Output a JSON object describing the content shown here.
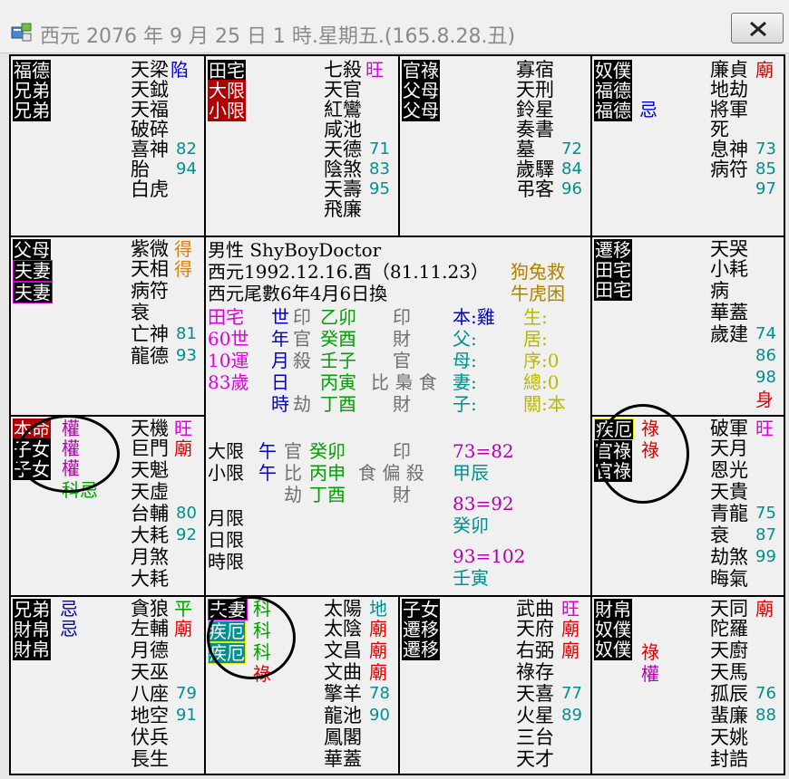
{
  "window": {
    "title": "西元 2076 年 9 月 25 日 1 時.星期五.(165.8.28.丑)",
    "close_label": "✕"
  },
  "palaces": [
    {
      "labels": [
        "福德",
        "兄弟",
        "兄弟"
      ],
      "stars": [
        [
          "天梁",
          "陷"
        ],
        [
          "天鉞",
          ""
        ],
        [
          "天福",
          ""
        ],
        [
          "破碎",
          ""
        ],
        [
          "喜神",
          "82"
        ],
        [
          "胎",
          "94"
        ],
        [
          "白虎",
          ""
        ]
      ]
    },
    {
      "labels": [
        "田宅",
        "大限",
        "小限"
      ],
      "stars": [
        [
          "七殺",
          "旺"
        ],
        [
          "天官",
          ""
        ],
        [
          "紅鸞",
          ""
        ],
        [
          "咸池",
          ""
        ],
        [
          "天德",
          "71"
        ],
        [
          "陰煞",
          "83"
        ],
        [
          "天壽",
          "95"
        ],
        [
          "飛廉",
          ""
        ]
      ]
    },
    {
      "labels": [
        "官祿",
        "父母",
        "父母"
      ],
      "stars": [
        [
          "寡宿",
          ""
        ],
        [
          "天刑",
          ""
        ],
        [
          "鈴星",
          ""
        ],
        [
          "奏書",
          ""
        ],
        [
          "墓",
          "72"
        ],
        [
          "歲驛",
          "84"
        ],
        [
          "弔客",
          "96"
        ]
      ]
    },
    {
      "labels": [
        "奴僕",
        "福德",
        "福德"
      ],
      "side": "忌",
      "stars": [
        [
          "廉貞",
          "廟"
        ],
        [
          "地劫",
          ""
        ],
        [
          "將軍",
          ""
        ],
        [
          "死",
          ""
        ],
        [
          "息神",
          "73"
        ],
        [
          "病符",
          "85"
        ],
        [
          "",
          "97"
        ]
      ]
    },
    {
      "labels": [
        "父母",
        "夫妻",
        "夫妻"
      ],
      "stars": [
        [
          "紫微",
          "得"
        ],
        [
          "天相",
          "得"
        ],
        [
          "病符",
          ""
        ],
        [
          "衰",
          ""
        ],
        [
          "亡神",
          "81"
        ],
        [
          "龍德",
          "93"
        ]
      ]
    },
    {
      "labels": [
        "遷移",
        "田宅",
        "田宅"
      ],
      "stars": [
        [
          "天哭",
          ""
        ],
        [
          "小耗",
          ""
        ],
        [
          "病",
          ""
        ],
        [
          "華蓋",
          ""
        ],
        [
          "歲建",
          "74"
        ],
        [
          "",
          "86"
        ],
        [
          "",
          "98"
        ],
        [
          "",
          "身"
        ]
      ]
    },
    {
      "labels": [
        "本命",
        "子女",
        "子女"
      ],
      "side": [
        "權",
        "權",
        "權",
        "科忌"
      ],
      "stars": [
        [
          "天機",
          "旺"
        ],
        [
          "巨門",
          "廟"
        ],
        [
          "天魁",
          ""
        ],
        [
          "天虛",
          ""
        ],
        [
          "台輔",
          "80"
        ],
        [
          "大耗",
          "92"
        ],
        [
          "月煞",
          ""
        ],
        [
          "大耗",
          ""
        ]
      ]
    },
    {
      "labels": [
        "疾厄",
        "官祿",
        "官祿"
      ],
      "side": [
        "祿",
        "祿"
      ],
      "stars": [
        [
          "破軍",
          "旺"
        ],
        [
          "天月",
          ""
        ],
        [
          "恩光",
          ""
        ],
        [
          "天貴",
          ""
        ],
        [
          "青龍",
          "75"
        ],
        [
          "衰",
          "87"
        ],
        [
          "劫煞",
          "99"
        ],
        [
          "晦氣",
          ""
        ]
      ]
    },
    {
      "labels": [
        "兄弟",
        "財帛",
        "財帛"
      ],
      "side": [
        "忌",
        "忌"
      ],
      "stars": [
        [
          "貪狼",
          "平"
        ],
        [
          "左輔",
          "廟"
        ],
        [
          "月德",
          ""
        ],
        [
          "天巫",
          ""
        ],
        [
          "八座",
          "79"
        ],
        [
          "地空",
          "91"
        ],
        [
          "伏兵",
          ""
        ],
        [
          "長生",
          ""
        ]
      ]
    },
    {
      "labels": [
        "夫妻",
        "疾厄",
        "疾厄"
      ],
      "side": [
        "科",
        "科",
        "科",
        "祿"
      ],
      "stars": [
        [
          "太陽",
          "地"
        ],
        [
          "太陰",
          "廟"
        ],
        [
          "文昌",
          "廟"
        ],
        [
          "文曲",
          "廟"
        ],
        [
          "擎羊",
          "78"
        ],
        [
          "龍池",
          "90"
        ],
        [
          "鳳閣",
          ""
        ],
        [
          "華蓋",
          ""
        ]
      ]
    },
    {
      "labels": [
        "子女",
        "遷移",
        "遷移"
      ],
      "stars": [
        [
          "武曲",
          "旺"
        ],
        [
          "天府",
          "廟"
        ],
        [
          "右弼",
          "廟"
        ],
        [
          "祿存",
          ""
        ],
        [
          "天喜",
          "77"
        ],
        [
          "火星",
          "89"
        ],
        [
          "三台",
          ""
        ],
        [
          "天才",
          ""
        ]
      ]
    },
    {
      "labels": [
        "財帛",
        "奴僕",
        "奴僕"
      ],
      "side": [
        "祿",
        "權"
      ],
      "stars": [
        [
          "天同",
          "廟"
        ],
        [
          "陀羅",
          ""
        ],
        [
          "天廚",
          ""
        ],
        [
          "天馬",
          ""
        ],
        [
          "孤辰",
          "76"
        ],
        [
          "蜚廉",
          "88"
        ],
        [
          "天姚",
          ""
        ],
        [
          "封誥",
          ""
        ]
      ]
    }
  ],
  "center": {
    "line1": "男性 ShyBoyDoctor",
    "line2": "西元1992.12.16.酉（81.11.23）",
    "line3": "西元尾數6年4月6日換",
    "tag1": "狗兔救",
    "tag2": "牛虎困",
    "left_col": [
      "田宅",
      "60世",
      "10運",
      "83歲"
    ],
    "pillar_heads": [
      "世",
      "年",
      "月",
      "日",
      "時"
    ],
    "pillar_a": [
      "印",
      "官",
      "殺",
      "",
      "劫"
    ],
    "pillars": [
      "乙卯",
      "癸酉",
      "壬子",
      "丙寅",
      "丁酉"
    ],
    "pillar_b": [
      "印",
      "財",
      "官",
      "比 梟 食",
      "財"
    ],
    "fam_labels": [
      "本:雞",
      "父:",
      "母:",
      "妻:",
      "子:"
    ],
    "right_labels": [
      "生:",
      "居:",
      "序:0",
      "總:0",
      "關:本"
    ],
    "daxian": "大限",
    "daxian_row": [
      "午",
      "官",
      "癸卯",
      "印"
    ],
    "xiaoxian": "小限",
    "xiaoxian_row": [
      "午",
      "比",
      "丙申",
      "食 偏 殺"
    ],
    "xiaoxian_row2": [
      "劫",
      "丁酉",
      "財"
    ],
    "yuexian": "月限",
    "rixian": "日限",
    "shixian": "時限",
    "range1": "73=82",
    "ganzhi1": "甲辰",
    "range2": "83=92",
    "ganzhi2": "癸卯",
    "range3": "93=102",
    "ganzhi3": "壬寅"
  }
}
